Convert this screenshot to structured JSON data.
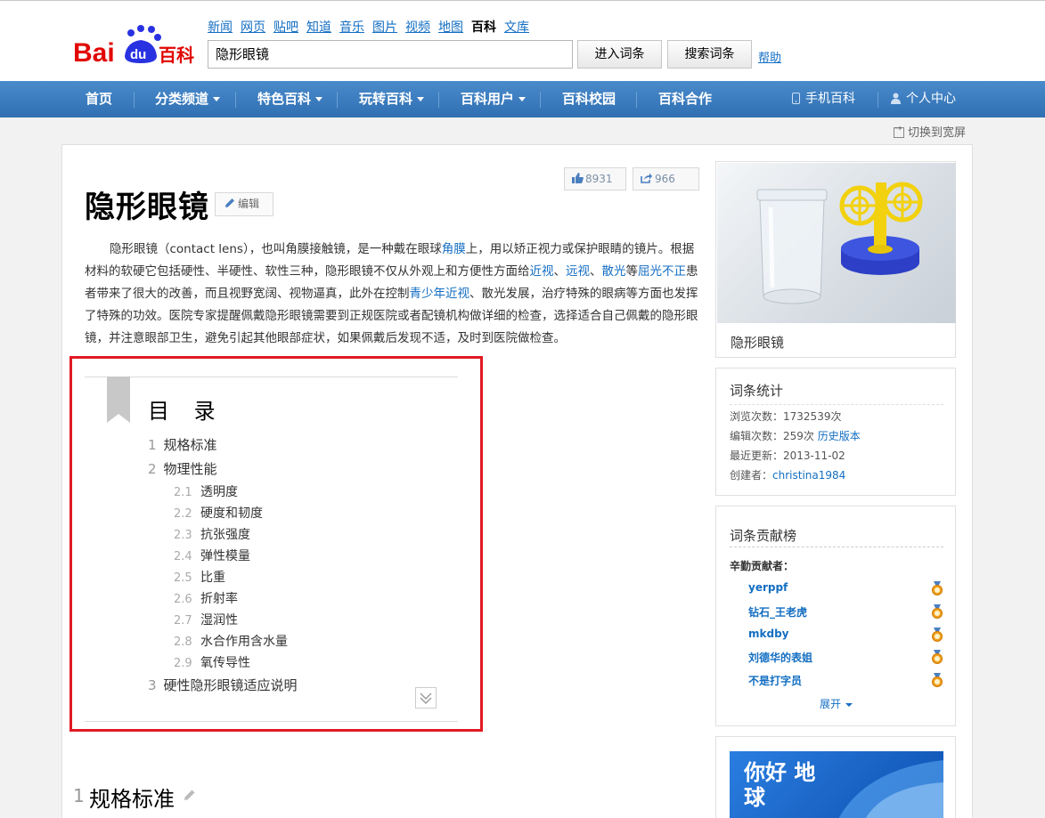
{
  "header": {
    "logo_text": "Bai du 百科",
    "nav": [
      "新闻",
      "网页",
      "贴吧",
      "知道",
      "音乐",
      "图片",
      "视频",
      "地图",
      "百科",
      "文库"
    ],
    "nav_current_index": 8,
    "search_value": "隐形眼镜",
    "enter_button": "进入词条",
    "search_button": "搜索词条",
    "help": "帮助"
  },
  "mainnav": {
    "items": [
      {
        "label": "首页",
        "dropdown": false
      },
      {
        "label": "分类频道",
        "dropdown": true
      },
      {
        "label": "特色百科",
        "dropdown": true
      },
      {
        "label": "玩转百科",
        "dropdown": true
      },
      {
        "label": "百科用户",
        "dropdown": true
      },
      {
        "label": "百科校园",
        "dropdown": false
      },
      {
        "label": "百科合作",
        "dropdown": false
      }
    ],
    "mobile": "手机百科",
    "personal": "个人中心"
  },
  "wide_switch": "切换到宽屏",
  "article": {
    "like_count": "8931",
    "share_count": "966",
    "title": "隐形眼镜",
    "edit_label": "编辑",
    "summary_parts": [
      {
        "t": "隐形眼镜（contact lens），也叫角膜接触镜，是一种戴在眼球"
      },
      {
        "t": "角膜",
        "link": true
      },
      {
        "t": "上，用以矫正视力或保护眼睛的镜片。根据材料的软硬它包括硬性、半硬性、软性三种，隐形眼镜不仅从外观上和方便性方面给"
      },
      {
        "t": "近视",
        "link": true
      },
      {
        "t": "、"
      },
      {
        "t": "远视",
        "link": true
      },
      {
        "t": "、"
      },
      {
        "t": "散光",
        "link": true
      },
      {
        "t": "等"
      },
      {
        "t": "屈光不正",
        "link": true
      },
      {
        "t": "患者带来了很大的改善，而且视野宽阔、视物逼真，此外在控制"
      },
      {
        "t": "青少年近视",
        "link": true
      },
      {
        "t": "、散光发展，治疗特殊的眼病等方面也发挥了特殊的功效。医院专家提醒佩戴隐形眼镜需要到正规医院或者配镜机构做详细的检查，选择适合自己佩戴的隐形眼镜，并注意眼部卫生，避免引起其他眼部症状，如果佩戴后发现不适，及时到医院做检查。"
      }
    ],
    "toc_title": "目 录",
    "toc": [
      {
        "num": "1",
        "label": "规格标准"
      },
      {
        "num": "2",
        "label": "物理性能"
      },
      {
        "num": "2.1",
        "label": "透明度"
      },
      {
        "num": "2.2",
        "label": "硬度和韧度"
      },
      {
        "num": "2.3",
        "label": "抗张强度"
      },
      {
        "num": "2.4",
        "label": "弹性模量"
      },
      {
        "num": "2.5",
        "label": "比重"
      },
      {
        "num": "2.6",
        "label": "折射率"
      },
      {
        "num": "2.7",
        "label": "湿润性"
      },
      {
        "num": "2.8",
        "label": "水合作用含水量"
      },
      {
        "num": "2.9",
        "label": "氧传导性"
      },
      {
        "num": "3",
        "label": "硬性隐形眼镜适应说明"
      }
    ],
    "section1_num": "1",
    "section1_title": "规格标准"
  },
  "sidebar": {
    "image_caption": "隐形眼镜",
    "stats_title": "词条统计",
    "views_label": "浏览次数：",
    "views": "1732539次",
    "edits_label": "编辑次数：",
    "edits": "259次",
    "history": "历史版本",
    "updated_label": "最近更新：",
    "updated": "2013-11-02",
    "creator_label": "创建者：",
    "creator": "christina1984",
    "contrib_title": "词条贡献榜",
    "contrib_sub": "辛勤贡献者：",
    "contributors": [
      "yerppf",
      "钻石_王老虎",
      "mkdby",
      "刘德华的表姐",
      "不是打字员"
    ],
    "expand": "展开",
    "ad_text": "你好 地球"
  }
}
